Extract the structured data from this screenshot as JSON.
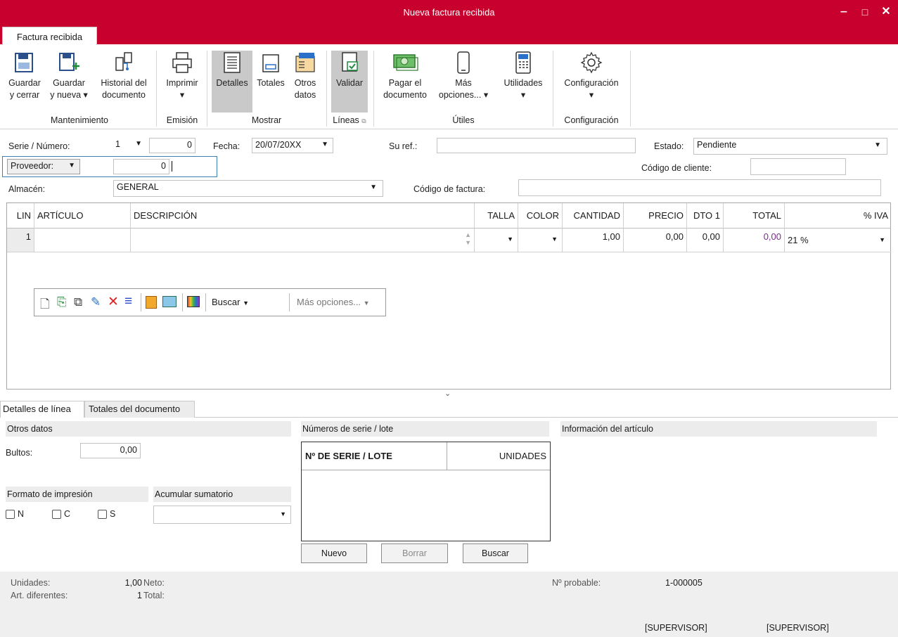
{
  "window": {
    "title": "Nueva factura recibida",
    "minimize": "‒",
    "maximize": "□",
    "close": "✕"
  },
  "ribbon": {
    "tab": "Factura recibida",
    "buttons": {
      "guardar_cerrar": [
        "Guardar",
        "y cerrar"
      ],
      "guardar_nueva": [
        "Guardar",
        "y nueva ▾"
      ],
      "historial": [
        "Historial del",
        "documento"
      ],
      "imprimir": [
        "Imprimir",
        "▾"
      ],
      "detalles": "Detalles",
      "totales": "Totales",
      "otros": [
        "Otros",
        "datos"
      ],
      "validar": "Validar",
      "pagar": [
        "Pagar el",
        "documento"
      ],
      "mas": [
        "Más",
        "opciones... ▾"
      ],
      "utilidades": [
        "Utilidades",
        "▾"
      ],
      "configuracion": [
        "Configuración",
        "▾"
      ]
    },
    "groups": {
      "mantenimiento": "Mantenimiento",
      "emision": "Emisión",
      "mostrar": "Mostrar",
      "lineas": "Líneas",
      "utiles": "Útiles",
      "configuracion": "Configuración"
    }
  },
  "form": {
    "serie_label": "Serie / Número:",
    "serie_value": "1",
    "numero_value": "0",
    "fecha_label": "Fecha:",
    "fecha_value": "20/07/20XX",
    "suref_label": "Su ref.:",
    "suref_value": "",
    "estado_label": "Estado:",
    "estado_value": "Pendiente",
    "proveedor_label": "Proveedor:",
    "proveedor_value": "0",
    "codcliente_label": "Código de cliente:",
    "codcliente_value": "",
    "almacen_label": "Almacén:",
    "almacen_value": "GENERAL",
    "codfactura_label": "Código de factura:",
    "codfactura_value": ""
  },
  "grid": {
    "headers": [
      "LIN",
      "ARTÍCULO",
      "DESCRIPCIÓN",
      "TALLA",
      "COLOR",
      "CANTIDAD",
      "PRECIO",
      "DTO 1",
      "TOTAL",
      "% IVA"
    ],
    "row": {
      "lin": "1",
      "articulo": "",
      "descripcion": "",
      "talla": "",
      "color": "",
      "cantidad": "1,00",
      "precio": "0,00",
      "dto1": "0,00",
      "total": "0,00",
      "iva": "21 %"
    },
    "toolbar": {
      "buscar": "Buscar",
      "mas_opciones": "Más opciones..."
    }
  },
  "bottom": {
    "tabs": [
      "Detalles de línea",
      "Totales del documento"
    ],
    "otros_datos": "Otros datos",
    "bultos_label": "Bultos:",
    "bultos_value": "0,00",
    "formato_label": "Formato de impresión",
    "acumular_label": "Acumular sumatorio",
    "checks": [
      "N",
      "C",
      "S"
    ],
    "series_title": "Números de serie / lote",
    "series_col1": "Nº DE SERIE / LOTE",
    "series_col2": "UNIDADES",
    "btn_nuevo": "Nuevo",
    "btn_borrar": "Borrar",
    "btn_buscar": "Buscar",
    "info_title": "Información del artículo"
  },
  "footer": {
    "unidades_label": "Unidades:",
    "unidades_value": "1,00",
    "neto_label": "Neto:",
    "artdif_label": "Art. diferentes:",
    "artdif_value": "1",
    "total_label": "Total:",
    "probable_label": "Nº probable:",
    "probable_value": "1-000005",
    "user1": "[SUPERVISOR]",
    "user2": "[SUPERVISOR]"
  },
  "colors": {
    "brand": "#c8002d",
    "selected": "#c9c9c9",
    "total_value": "#7a2a8c"
  }
}
